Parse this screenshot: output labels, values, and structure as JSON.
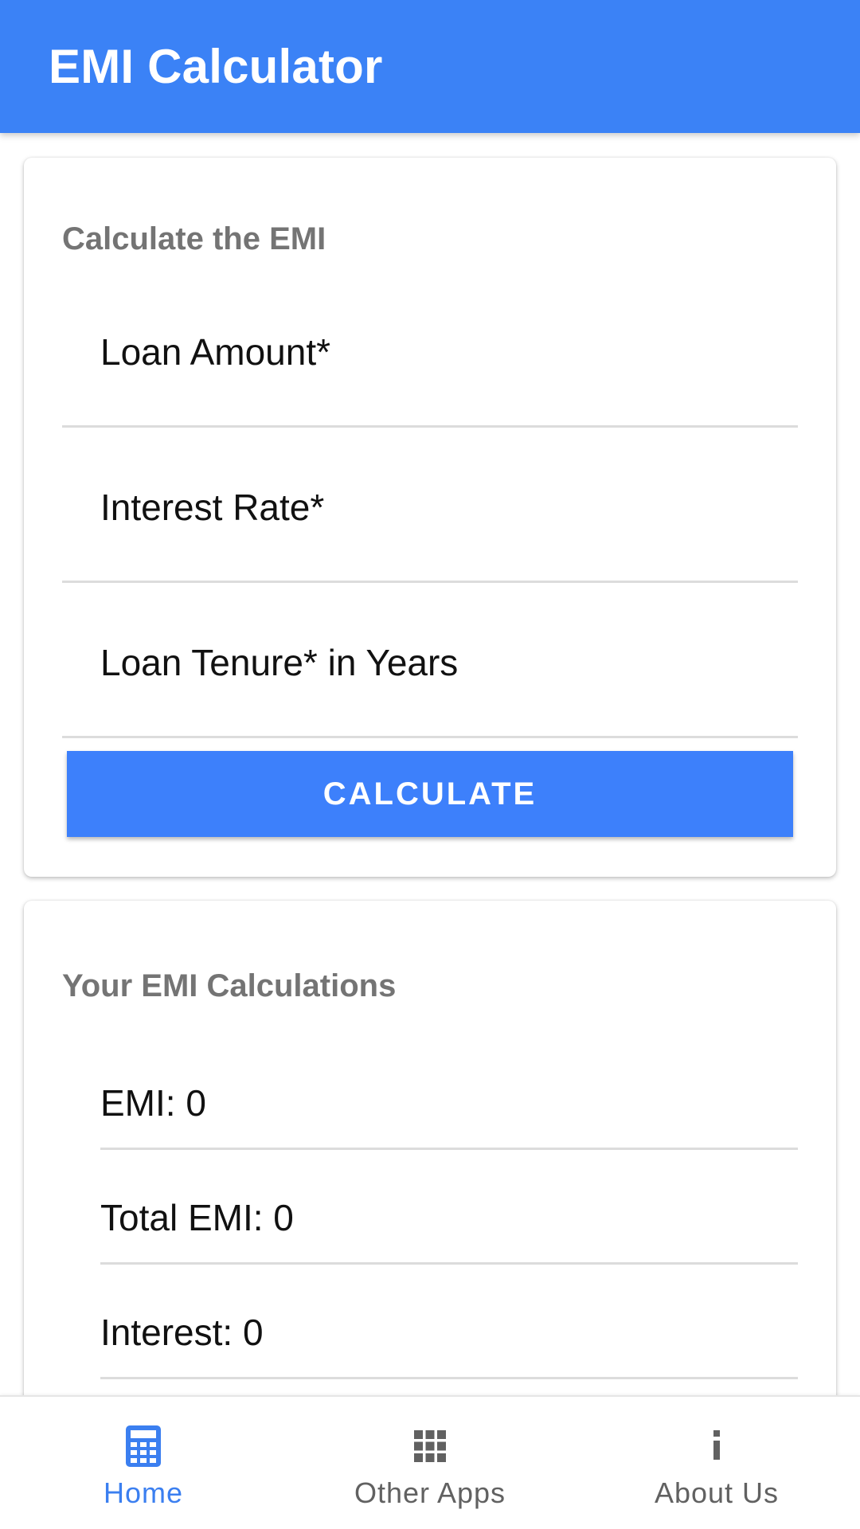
{
  "app_bar": {
    "title": "EMI Calculator"
  },
  "calc_card": {
    "title": "Calculate the EMI",
    "fields": [
      {
        "label": "Loan Amount*",
        "value": ""
      },
      {
        "label": "Interest Rate*",
        "value": ""
      },
      {
        "label": "Loan Tenure* in Years",
        "value": ""
      }
    ],
    "button_label": "CALCULATE"
  },
  "results_card": {
    "title": "Your EMI Calculations",
    "rows": [
      {
        "text": "EMI: 0"
      },
      {
        "text": "Total EMI: 0"
      },
      {
        "text": "Interest: 0"
      },
      {
        "text": ""
      }
    ]
  },
  "bottom_nav": {
    "items": [
      {
        "label": "Home",
        "icon": "calculator-icon",
        "active": true
      },
      {
        "label": "Other Apps",
        "icon": "apps-grid-icon",
        "active": false
      },
      {
        "label": "About Us",
        "icon": "info-icon",
        "active": false
      }
    ]
  },
  "colors": {
    "primary": "#3b82f6",
    "button": "#3d80fb",
    "active_nav": "#3b7ff0",
    "inactive_nav": "#616161",
    "card_title": "#747474"
  }
}
